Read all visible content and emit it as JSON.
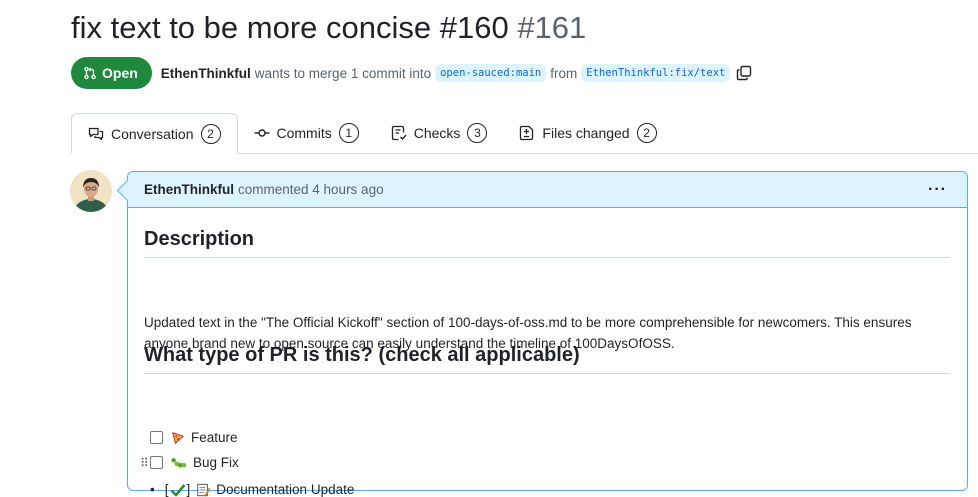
{
  "pr": {
    "title": "fix text to be more concise #160",
    "number": "#161",
    "state": "Open",
    "author": "EthenThinkful",
    "merge_text": "wants to merge 1 commit into",
    "base_branch": "open-sauced:main",
    "from_text": "from",
    "head_branch": "EthenThinkful:fix/text"
  },
  "tabs": [
    {
      "label": "Conversation",
      "count": "2",
      "icon": "comment-discussion-icon"
    },
    {
      "label": "Commits",
      "count": "1",
      "icon": "git-commit-icon"
    },
    {
      "label": "Checks",
      "count": "3",
      "icon": "checklist-icon"
    },
    {
      "label": "Files changed",
      "count": "2",
      "icon": "file-diff-icon"
    }
  ],
  "comment": {
    "author": "EthenThinkful",
    "meta": "commented 4 hours ago",
    "menu": "···"
  },
  "body": {
    "h_description": "Description",
    "p_description": "Updated text in the \"The Official Kickoff\" section of 100-days-of-oss.md to be more comprehensible for newcomers. This ensures anyone brand new to open source can easily understand the timeline of 100DaysOfOSS.",
    "h_type": "What type of PR is this? (check all applicable)",
    "tasks": [
      {
        "label": "Feature",
        "icon": "pizza-emoji",
        "checked": false
      },
      {
        "label": "Bug Fix",
        "icon": "caterpillar-emoji",
        "checked": false
      },
      {
        "label": "Documentation Update",
        "icon": "memo-emoji",
        "checked": true,
        "prefix": "[",
        "suffix": "]"
      }
    ]
  },
  "colors": {
    "open_green": "#1f883d",
    "accent_blue": "#0969da",
    "comment_header_bg": "#ddf4ff",
    "comment_border": "#54aeff"
  }
}
